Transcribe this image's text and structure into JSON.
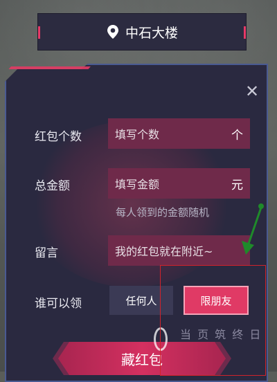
{
  "location": {
    "name": "中石大楼",
    "icon": "map-pin-icon"
  },
  "form": {
    "count": {
      "label": "红包个数",
      "placeholder": "填写个数",
      "unit": "个"
    },
    "amount": {
      "label": "总金额",
      "placeholder": "填写金额",
      "unit": "元",
      "hint": "每人领到的金额随机"
    },
    "message": {
      "label": "留言",
      "value": "我的红包就在附近~"
    },
    "who": {
      "label": "谁可以领",
      "options": [
        "任何人",
        "限朋友"
      ],
      "selected": "限朋友"
    },
    "partial_text": "当 页 筑 终 日"
  },
  "actions": {
    "stash_label": "藏红包"
  },
  "colors": {
    "accent": "#e03a65",
    "panel": "#2a2940",
    "field": "#6f2a4a",
    "annotation_red": "#d1232b",
    "annotation_green": "#1f8a2a"
  }
}
